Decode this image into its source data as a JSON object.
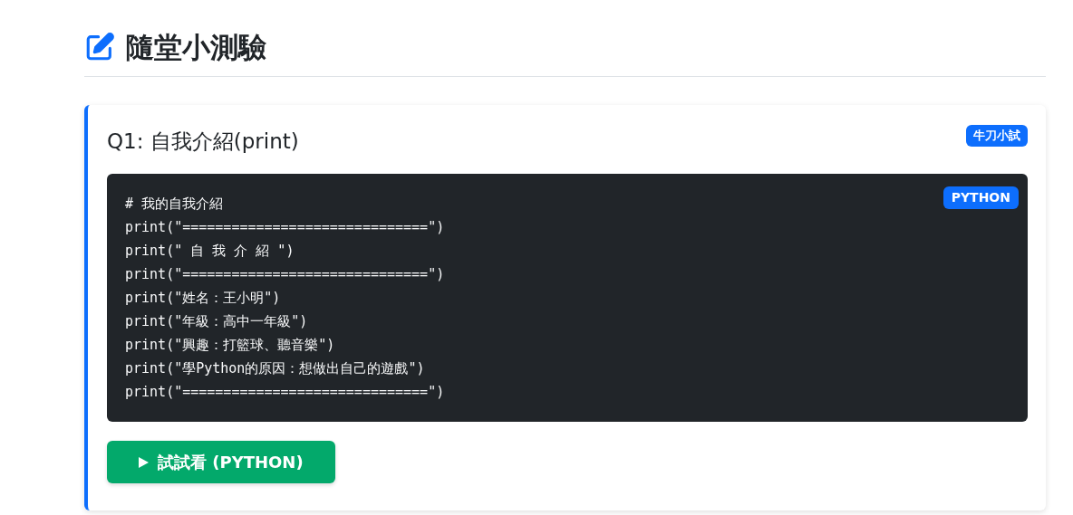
{
  "page_title": "隨堂小測驗",
  "question": {
    "title": "Q1: 自我介紹(print)",
    "badge": "牛刀小試",
    "code": {
      "language": "PYTHON",
      "lines": [
        "# 我的自我介紹",
        "print(\"==============================\")",
        "print(\" 自 我 介 紹 \")",
        "print(\"==============================\")",
        "print(\"姓名：王小明\")",
        "print(\"年級：高中一年級\")",
        "print(\"興趣：打籃球、聽音樂\")",
        "print(\"學Python的原因：想做出自己的遊戲\")",
        "print(\"==============================\")"
      ]
    },
    "run_button": "試試看 (PYTHON)"
  }
}
